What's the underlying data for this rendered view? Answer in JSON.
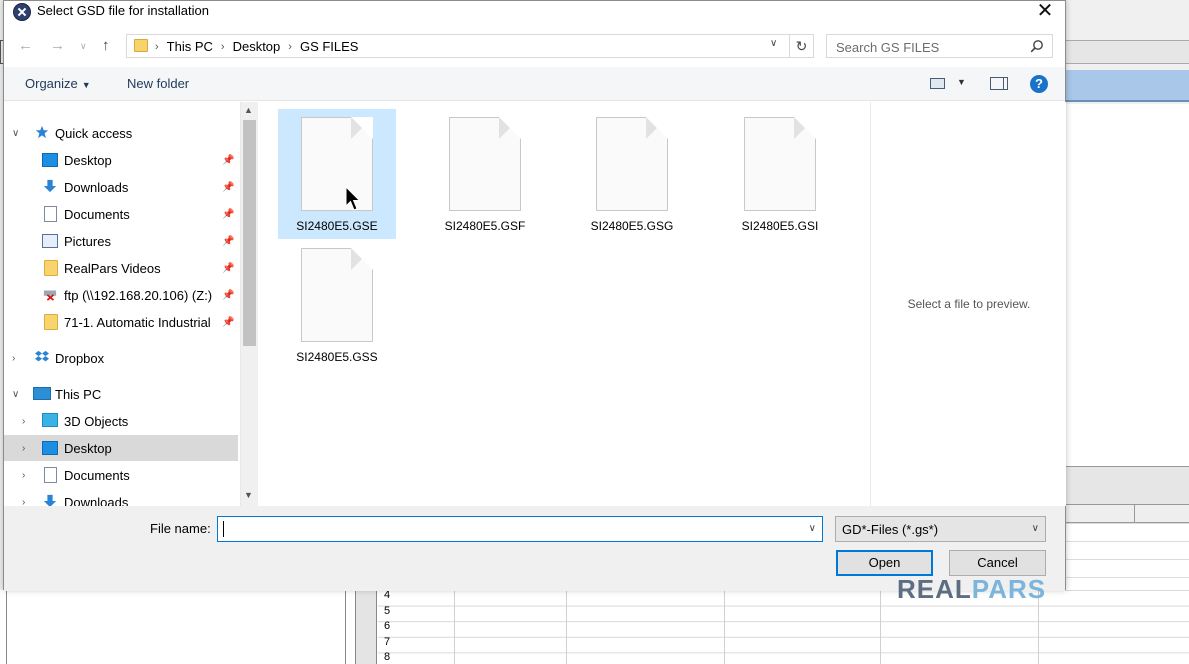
{
  "dialog": {
    "title": "Select GSD file for installation",
    "close": "✕"
  },
  "address": {
    "crumbs": [
      "This PC",
      "Desktop",
      "GS FILES"
    ],
    "sep": "›",
    "search_placeholder": "Search GS FILES"
  },
  "toolbar": {
    "organize": "Organize",
    "new_folder": "New folder",
    "help": "?"
  },
  "nav": {
    "quick_access": "Quick access",
    "quick_items": [
      "Desktop",
      "Downloads",
      "Documents",
      "Pictures",
      "RealPars Videos",
      "ftp (\\\\192.168.20.106) (Z:)",
      "71-1. Automatic Industrial"
    ],
    "dropbox": "Dropbox",
    "this_pc": "This PC",
    "pc_items": [
      "3D Objects",
      "Desktop",
      "Documents",
      "Downloads"
    ]
  },
  "files": [
    {
      "name": "SI2480E5.GSE",
      "selected": true
    },
    {
      "name": "SI2480E5.GSF",
      "selected": false
    },
    {
      "name": "SI2480E5.GSG",
      "selected": false
    },
    {
      "name": "SI2480E5.GSI",
      "selected": false
    },
    {
      "name": "SI2480E5.GSS",
      "selected": false
    }
  ],
  "preview": {
    "text": "Select a file to preview."
  },
  "bottom": {
    "file_name_label": "File name:",
    "file_name_value": "",
    "file_type": "GD*-Files (*.gs*)",
    "open": "Open",
    "cancel": "Cancel"
  },
  "background": {
    "row_numbers": [
      "4",
      "5",
      "6",
      "7",
      "8"
    ]
  },
  "watermark": {
    "part1": "REAL",
    "part2": "PARS"
  },
  "colors": {
    "selection": "#cce8ff",
    "accent": "#0078d7",
    "nav_selected": "#d9d9d9"
  }
}
